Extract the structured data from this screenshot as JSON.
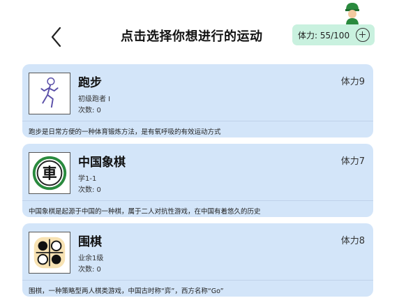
{
  "header": {
    "title": "点击选择你想进行的运动",
    "stamina": "体力: 55/100"
  },
  "sports": [
    {
      "name": "跑步",
      "level": "初级跑者 I",
      "count": "次数: 0",
      "cost": "体力9",
      "description": "跑步是日常方便的一种体育锻炼方法，是有氧呼吸的有效运动方式",
      "icon": "runner-icon"
    },
    {
      "name": "中国象棋",
      "level": "学1-1",
      "count": "次数: 0",
      "cost": "体力7",
      "description": "中国象棋是起源于中国的一种棋，属于二人对抗性游戏，在中国有着悠久的历史",
      "icon": "chinese-chess-icon",
      "icon_text": "車"
    },
    {
      "name": "围棋",
      "level": "业余1级",
      "count": "次数: 0",
      "cost": "体力8",
      "description": "围棋，一种策略型两人棋类游戏，中国古时称“弈”，西方名称“Go”",
      "icon": "go-icon"
    }
  ],
  "colors": {
    "card_bg": "#d3e5f9",
    "stamina_bg": "#c9f1df",
    "avatar_green": "#2a8a3e"
  }
}
